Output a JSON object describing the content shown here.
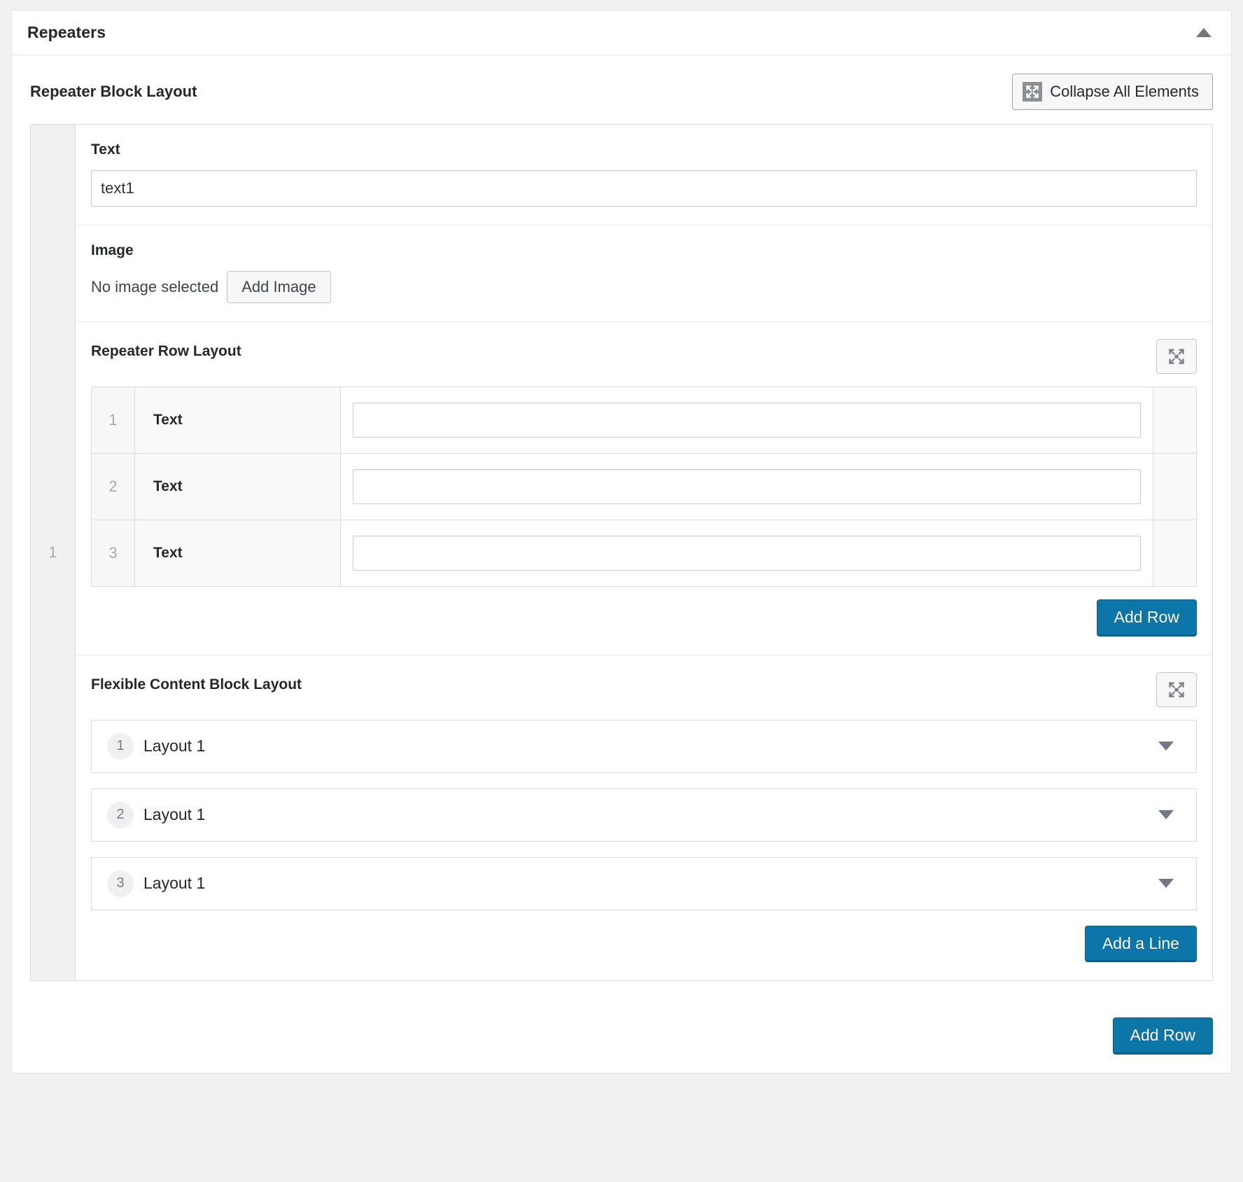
{
  "panel": {
    "title": "Repeaters",
    "toggle_icon": "caret-up-icon"
  },
  "repeater_block": {
    "label": "Repeater Block Layout",
    "collapse_all_button": {
      "label": "Collapse All Elements",
      "icon": "collapse-arrows-icon"
    },
    "row_order": "1",
    "fields": {
      "text": {
        "label": "Text",
        "value": "text1",
        "placeholder": ""
      },
      "image": {
        "label": "Image",
        "empty_text": "No image selected",
        "add_button": "Add Image"
      }
    },
    "add_row_button": "Add Row"
  },
  "repeater_row_layout": {
    "label": "Repeater Row Layout",
    "expand_icon": "expand-arrows-icon",
    "rows": [
      {
        "order": "1",
        "name": "Text",
        "value": "",
        "placeholder": ""
      },
      {
        "order": "2",
        "name": "Text",
        "value": "",
        "placeholder": ""
      },
      {
        "order": "3",
        "name": "Text",
        "value": "",
        "placeholder": ""
      }
    ],
    "add_row_button": "Add Row"
  },
  "flexible_content_block": {
    "label": "Flexible Content Block Layout",
    "expand_icon": "expand-arrows-icon",
    "layouts": [
      {
        "order": "1",
        "title": "Layout 1",
        "caret": "caret-down-icon"
      },
      {
        "order": "2",
        "title": "Layout 1",
        "caret": "caret-down-icon"
      },
      {
        "order": "3",
        "title": "Layout 1",
        "caret": "caret-down-icon"
      }
    ],
    "add_line_button": "Add a Line"
  },
  "colors": {
    "primary_button": "#0d76a8",
    "panel_background": "#ffffff",
    "page_background": "#f1f1f1",
    "text": "#23282d",
    "muted": "#a7aaad"
  }
}
